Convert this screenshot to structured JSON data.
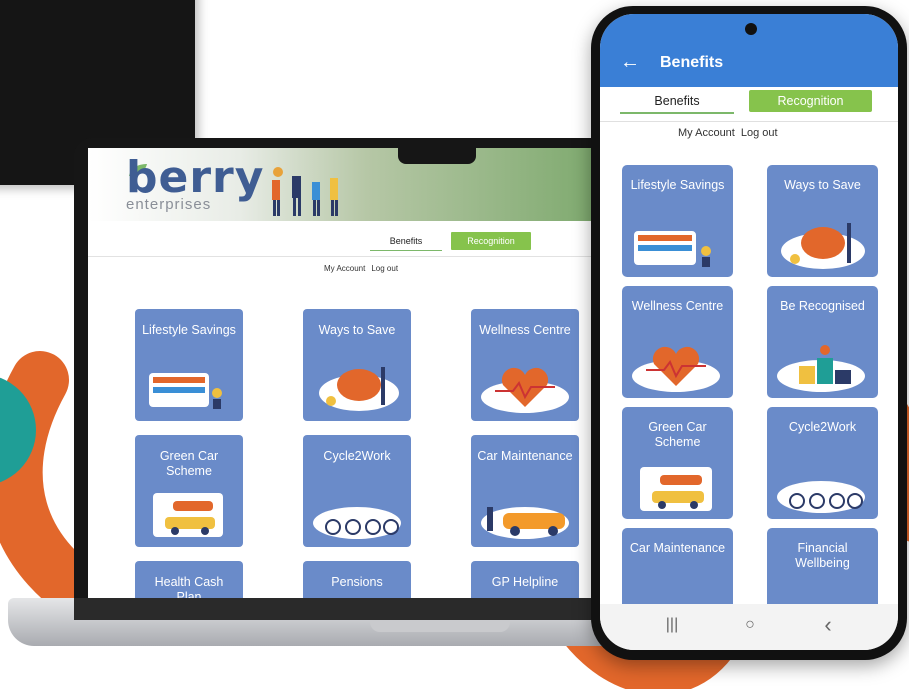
{
  "laptop": {
    "brand": {
      "name": "berry",
      "sub": "enterprises"
    },
    "nav": {
      "benefits": "Benefits",
      "recognition": "Recognition"
    },
    "links": {
      "account": "My Account",
      "logout": "Log out"
    },
    "tiles": [
      {
        "label": "Lifestyle Savings"
      },
      {
        "label": "Ways to Save"
      },
      {
        "label": "Wellness Centre"
      },
      {
        "label": "Green Car Scheme"
      },
      {
        "label": "Cycle2Work"
      },
      {
        "label": "Car Maintenance"
      },
      {
        "label": "Health Cash Plan"
      },
      {
        "label": "Pensions"
      },
      {
        "label": "GP Helpline"
      }
    ]
  },
  "phone": {
    "appbar": {
      "title": "Benefits",
      "back_icon": "arrow-left-icon"
    },
    "nav": {
      "benefits": "Benefits",
      "recognition": "Recognition"
    },
    "links": {
      "account": "My Account",
      "logout": "Log out"
    },
    "tiles": [
      {
        "label": "Lifestyle Savings"
      },
      {
        "label": "Ways to Save"
      },
      {
        "label": "Wellness Centre"
      },
      {
        "label": "Be Recognised"
      },
      {
        "label": "Green Car Scheme"
      },
      {
        "label": "Cycle2Work"
      },
      {
        "label": "Car Maintenance"
      },
      {
        "label": "Financial Wellbeing"
      }
    ],
    "system_nav": {
      "recents": "|||",
      "home": "○",
      "back": "‹"
    }
  },
  "colors": {
    "tile": "#6a8bc9",
    "accent_green": "#86c34c",
    "appbar_blue": "#3a7fd6",
    "brand_blue": "#3f5d93",
    "swoosh_orange": "#e2672b",
    "teal": "#1f9e96"
  }
}
